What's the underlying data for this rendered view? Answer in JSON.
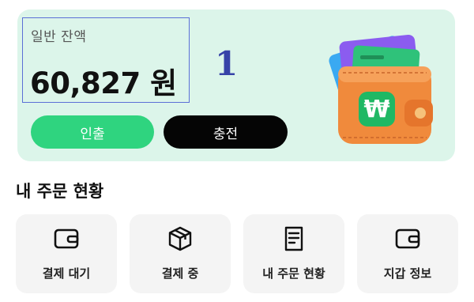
{
  "balance": {
    "label": "일반 잔액",
    "amount": "60,827 원",
    "annotation": "1"
  },
  "actions": {
    "withdraw_label": "인출",
    "charge_label": "충전"
  },
  "orders_section": {
    "title": "내 주문 현황",
    "tiles": [
      {
        "label": "결제 대기",
        "icon": "wallet-icon"
      },
      {
        "label": "결제 중",
        "icon": "package-box-icon"
      },
      {
        "label": "내 주문 현황",
        "icon": "document-list-icon"
      },
      {
        "label": "지갑 정보",
        "icon": "wallet-icon"
      }
    ]
  },
  "colors": {
    "card_background": "#dcf5ea",
    "withdraw_button": "#2fd47f",
    "charge_button": "#050505",
    "annotation": "#3743a8",
    "highlight_box": "#5b6fd6",
    "tile_background": "#f4f4f4"
  }
}
